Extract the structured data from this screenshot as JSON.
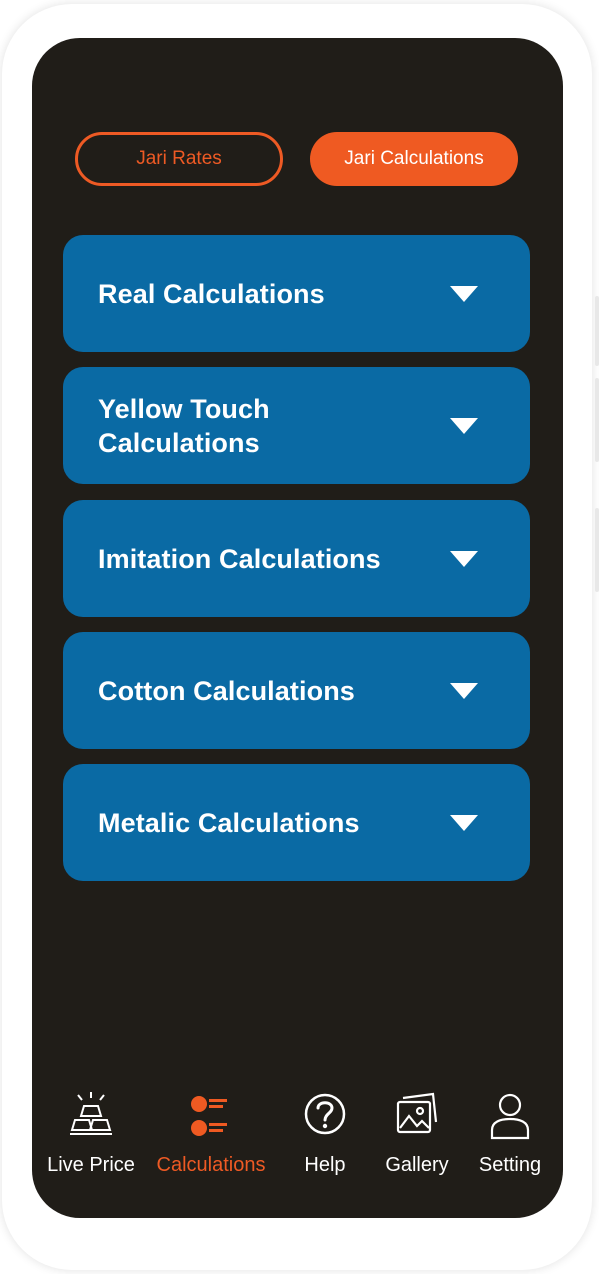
{
  "top_tabs": {
    "rates_label": "Jari Rates",
    "calculations_label": "Jari Calculations"
  },
  "sections": [
    {
      "label": "Real Calculations"
    },
    {
      "label": "Yellow Touch Calculations"
    },
    {
      "label": "Imitation Calculations"
    },
    {
      "label": "Cotton Calculations"
    },
    {
      "label": "Metalic Calculations"
    }
  ],
  "bottom_nav": {
    "items": [
      {
        "label": "Live Price",
        "icon": "gold-bars-icon"
      },
      {
        "label": "Calculations",
        "icon": "list-icon",
        "active": true
      },
      {
        "label": "Help",
        "icon": "question-icon"
      },
      {
        "label": "Gallery",
        "icon": "gallery-icon"
      },
      {
        "label": "Setting",
        "icon": "user-icon"
      }
    ]
  },
  "colors": {
    "background": "#201d18",
    "accent": "#ef5a22",
    "card": "#0a6aa4",
    "text": "#ffffff"
  }
}
